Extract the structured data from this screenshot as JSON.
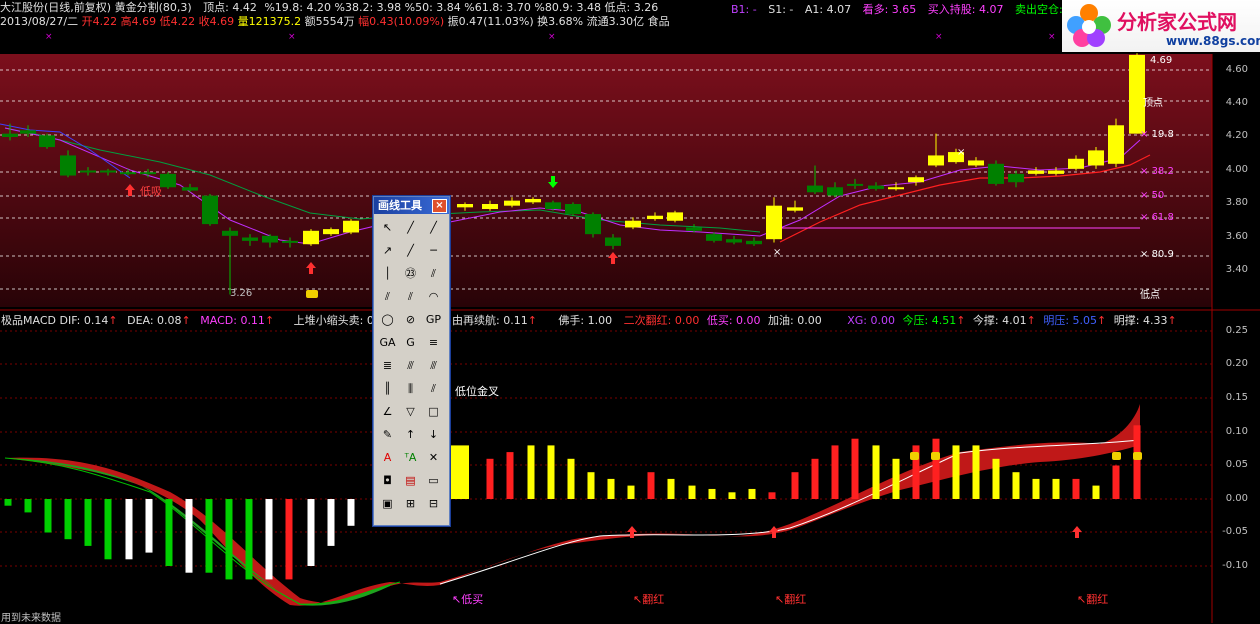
{
  "header": {
    "stock_info": "大江股份(日线,前复权) 黄金分割(80,3)",
    "vertex_label": "顶点: 4.42",
    "fib_levels": "%19.8: 4.20  %38.2: 3.98  %50: 3.84  %61.8: 3.70  %80.9: 3.48  低点: 3.26",
    "signal_b1": "B1: -",
    "signal_s1": "S1: -",
    "signal_a1": "A1: 4.07",
    "kanduo": "看多: 3.65",
    "buy_hold": "买入持股: 4.07",
    "sell_empty": "卖出空仓:",
    "date_line": "2013/08/27/二",
    "open": "开4.22",
    "high": "高4.69",
    "low": "低4.22",
    "close": "收4.69",
    "volume": "量121375.2",
    "amount": "额5554万",
    "change": "幅0.43(10.09%)",
    "amplitude": "振0.47(11.03%)",
    "turnover": "换3.68%",
    "float": "流通3.30亿",
    "sector": "食品"
  },
  "logo": {
    "title": "分析家公式网",
    "url": "www.88gs.com"
  },
  "price_panel": {
    "right_labels": [
      "4.69",
      "顶点",
      "19.8",
      "38.2",
      "50",
      "61.8",
      "80.9",
      "低点"
    ],
    "axis_ticks": [
      "4.60",
      "4.40",
      "4.20",
      "4.00",
      "3.80",
      "3.60",
      "3.40"
    ],
    "low_marker": "3.26",
    "buy_signal": "低吸"
  },
  "indicator_bar": {
    "name": "极品MACD",
    "dif": "DIF: 0.14",
    "dea": "DEA: 0.08",
    "macd": "MACD: 0.11",
    "upper_small": "上堆小缩头卖: 0",
    "relaunch": "由再续航: 0.11",
    "foshou": "佛手: 1.00",
    "second_red": "二次翻红: 0.00",
    "low_buy": "低买: 0.00",
    "add_oil": "加油: 0.00",
    "xg": "XG: 0.00",
    "today_press": "今压: 4.51",
    "today_support": "今撑: 4.01",
    "tomorrow_press": "明压: 5.05",
    "tomorrow_support": "明撑: 4.33"
  },
  "macd_panel": {
    "axis_ticks": [
      "0.25",
      "0.20",
      "0.15",
      "0.10",
      "0.05",
      "0.00",
      "-0.05",
      "-0.10"
    ],
    "golden_cross": "低位金叉",
    "signals": [
      "↖低买",
      "↖翻红",
      "↖翻红",
      "↖翻红"
    ],
    "footer_note": "用到未来数据"
  },
  "toolbox": {
    "title": "画线工具",
    "close": "×",
    "tools": [
      "arrow-select",
      "line",
      "ray",
      "arrow-line",
      "segment",
      "horizontal-line",
      "vertical-line",
      "price-label",
      "parallel",
      "parallel-2",
      "parallel-3",
      "arc",
      "circle",
      "no-entry",
      "gp",
      "ga",
      "gs",
      "ext",
      "fib-fan",
      "speed",
      "gann",
      "fib-time",
      "cycle",
      "lines-v",
      "multi-lines",
      "channel",
      "fan",
      "triangle",
      "rectangle",
      "pencil",
      "up-arrow",
      "down-arrow",
      "text",
      "text-a",
      "delete",
      "color",
      "props",
      "bar",
      "note"
    ]
  },
  "colors": {
    "up": "#ff2020",
    "down": "#00ff00",
    "yellow": "#ffff00",
    "panel_bg": "#6e0d18",
    "grid": "#7a0000"
  }
}
